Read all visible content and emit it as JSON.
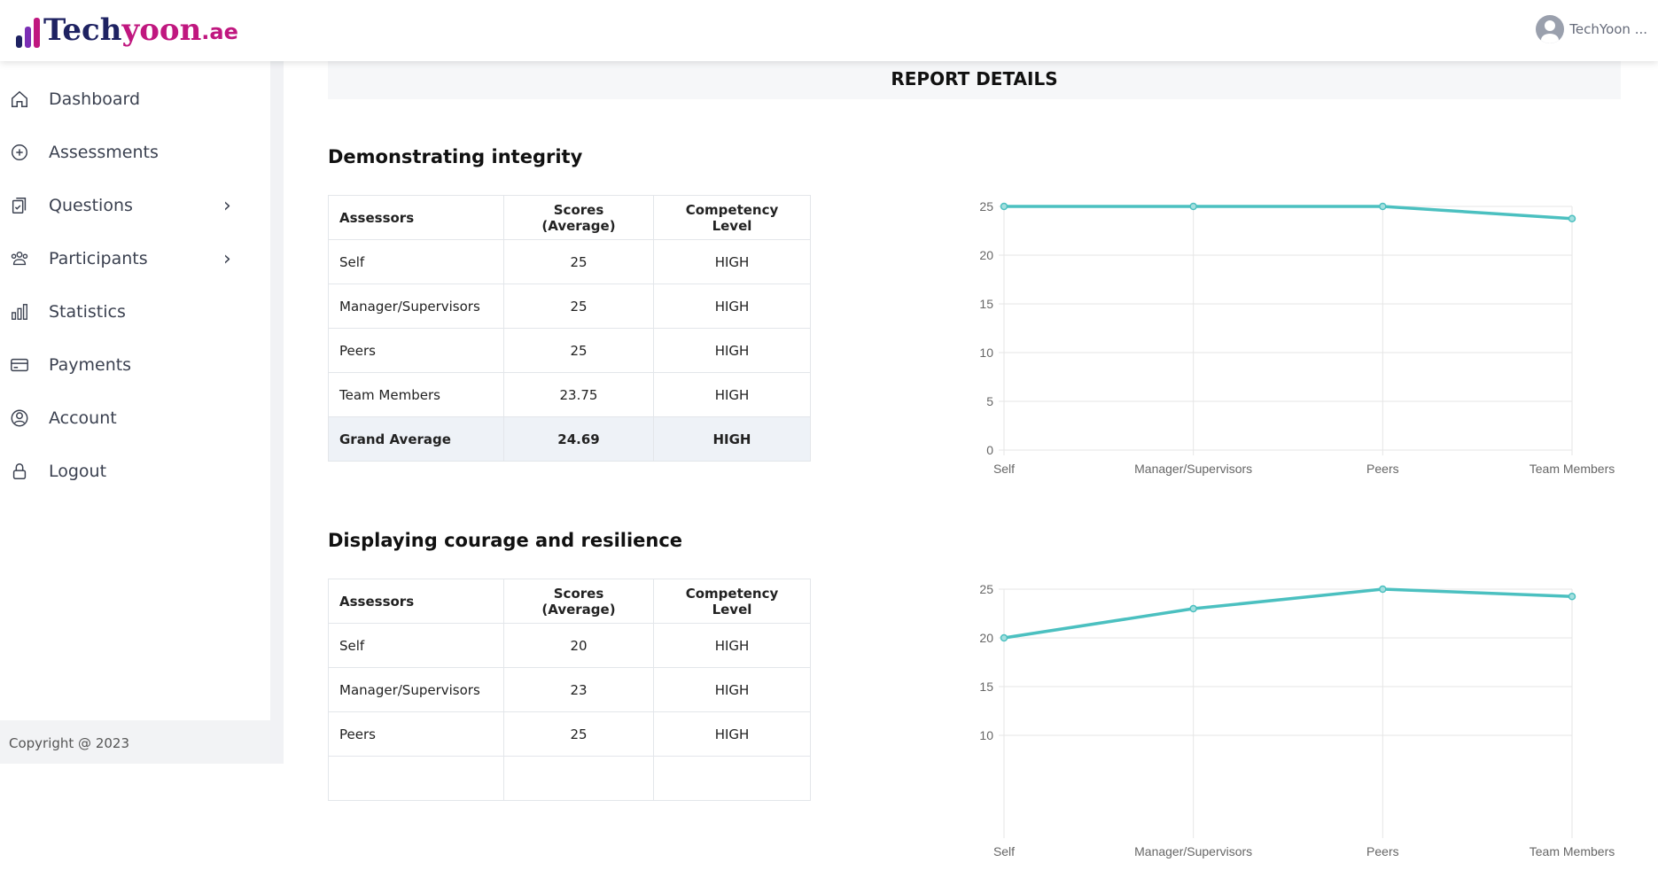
{
  "brand": {
    "logo_part1": "Tech",
    "logo_part2": "yoon",
    "logo_part3": ".ae",
    "colors": {
      "navy": "#1e2262",
      "magenta": "#c0177f",
      "purple": "#7b2fb5"
    }
  },
  "header": {
    "user_name": "TechYoon ..."
  },
  "sidebar": {
    "items": [
      {
        "label": "Dashboard",
        "icon": "home-icon"
      },
      {
        "label": "Assessments",
        "icon": "plus-circle-icon"
      },
      {
        "label": "Questions",
        "icon": "clipboard-check-icon",
        "has_submenu": true
      },
      {
        "label": "Participants",
        "icon": "users-icon",
        "has_submenu": true
      },
      {
        "label": "Statistics",
        "icon": "bar-chart-icon"
      },
      {
        "label": "Payments",
        "icon": "credit-card-icon"
      },
      {
        "label": "Account",
        "icon": "user-circle-icon"
      },
      {
        "label": "Logout",
        "icon": "lock-icon"
      }
    ],
    "footer": "Copyright @ 2023"
  },
  "main": {
    "title": "REPORT DETAILS",
    "table_headers": [
      "Assessors",
      "Scores (Average)",
      "Competency Level"
    ],
    "sections": [
      {
        "title": "Demonstrating integrity",
        "rows": [
          [
            "Self",
            "25",
            "HIGH"
          ],
          [
            "Manager/Supervisors",
            "25",
            "HIGH"
          ],
          [
            "Peers",
            "25",
            "HIGH"
          ],
          [
            "Team Members",
            "23.75",
            "HIGH"
          ]
        ],
        "grand": [
          "Grand Average",
          "24.69",
          "HIGH"
        ]
      },
      {
        "title": "Displaying courage and resilience",
        "rows": [
          [
            "Self",
            "20",
            "HIGH"
          ],
          [
            "Manager/Supervisors",
            "23",
            "HIGH"
          ],
          [
            "Peers",
            "25",
            "HIGH"
          ]
        ]
      }
    ]
  },
  "chart_data": [
    {
      "type": "line",
      "categories": [
        "Self",
        "Manager/Supervisors",
        "Peers",
        "Team Members"
      ],
      "values": [
        25,
        25,
        25,
        23.75
      ],
      "ylim": [
        0,
        25
      ],
      "yticks": [
        0,
        5,
        10,
        15,
        20,
        25
      ],
      "grid": true,
      "color": "#4bc0c0"
    },
    {
      "type": "line",
      "categories": [
        "Self",
        "Manager/Supervisors",
        "Peers",
        "Team Members"
      ],
      "values": [
        20,
        23,
        25,
        24.25
      ],
      "ylim": [
        0,
        25
      ],
      "yticks": [
        10,
        15,
        20,
        25
      ],
      "grid": true,
      "color": "#4bc0c0"
    }
  ]
}
